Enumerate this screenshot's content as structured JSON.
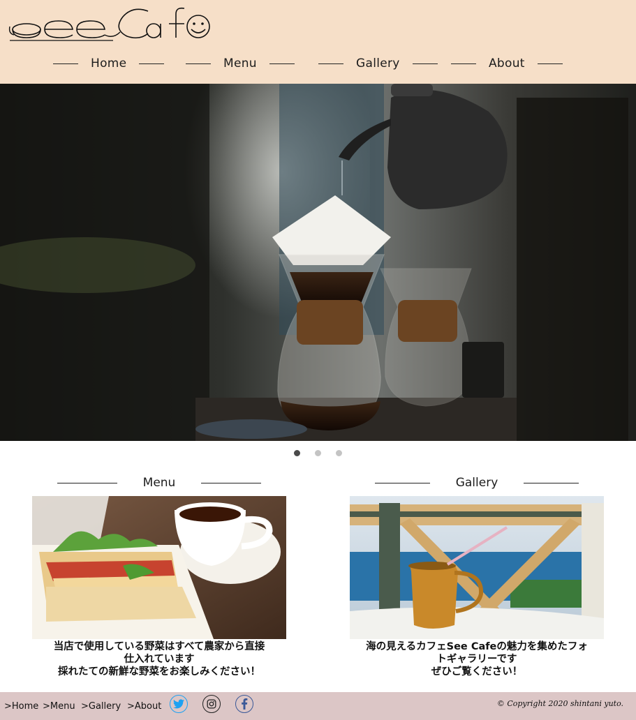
{
  "header": {
    "logo_text": "See Cafe",
    "nav": [
      {
        "label": "Home"
      },
      {
        "label": "Menu"
      },
      {
        "label": "Gallery"
      },
      {
        "label": "About"
      }
    ]
  },
  "hero": {
    "image": "coffee-pour-over-hero",
    "slides_total": 3,
    "active_slide": 1
  },
  "sections": [
    {
      "title": "Menu",
      "image": "sandwich-and-coffee-photo",
      "caption_lines": [
        "当店で使用している野菜はすべて農家から直接",
        "仕入れています",
        "採れたての新鮮な野菜をお楽しみください！"
      ]
    },
    {
      "title": "Gallery",
      "image": "seaside-cafe-pitcher-photo",
      "caption_lines": [
        "海の見えるカフェSee Cafeの魅力を集めたフォ",
        "トギャラリーです",
        "ぜひご覧ください！"
      ]
    }
  ],
  "footer": {
    "links": [
      ">Home",
      ">Menu",
      ">Gallery",
      ">About"
    ],
    "social": [
      {
        "icon": "twitter-icon",
        "color": "#1da1f2"
      },
      {
        "icon": "instagram-icon",
        "color": "#222222"
      },
      {
        "icon": "facebook-icon",
        "color": "#3b5998"
      }
    ],
    "copyright": "© Copyright 2020 shintani yuto."
  },
  "colors": {
    "header_bg": "#f6dfc8",
    "footer_bg": "#dcc6c6",
    "text": "#1c1c1c"
  }
}
